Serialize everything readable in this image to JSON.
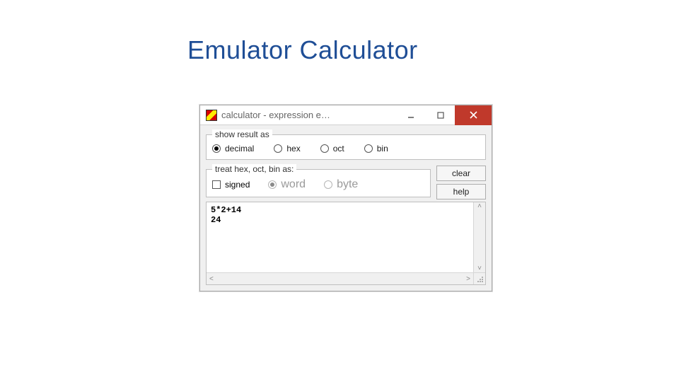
{
  "slide": {
    "title": "Emulator Calculator"
  },
  "window": {
    "title": "calculator - expression e…",
    "group1": {
      "legend": "show result as",
      "options": {
        "decimal": "decimal",
        "hex": "hex",
        "oct": "oct",
        "bin": "bin"
      },
      "selected": "decimal"
    },
    "group2": {
      "legend": "treat hex, oct, bin as:",
      "signed_label": "signed",
      "options": {
        "word": "word",
        "byte": "byte"
      },
      "selected": "word"
    },
    "buttons": {
      "clear": "clear",
      "help": "help"
    },
    "output": "5*2+14\n24"
  }
}
